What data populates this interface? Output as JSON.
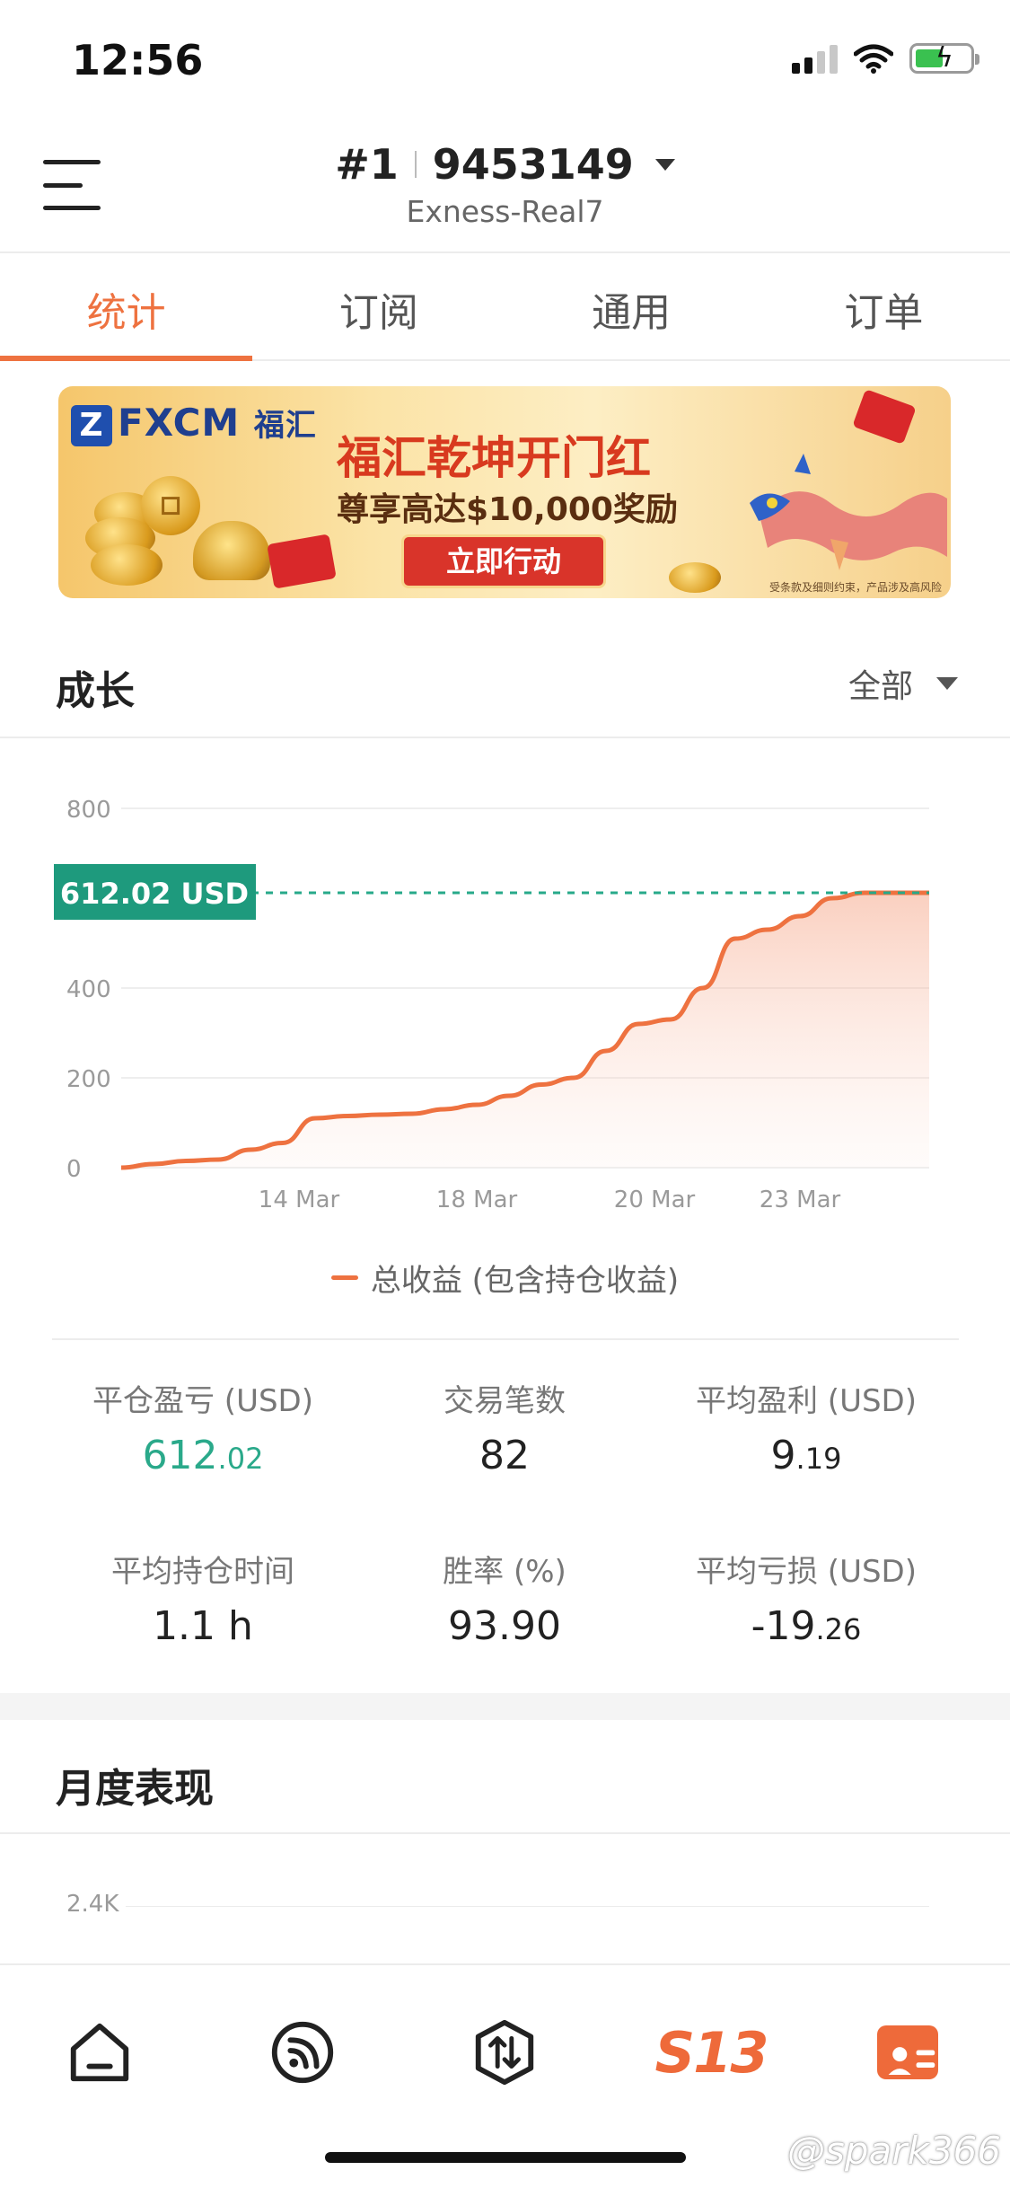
{
  "status_bar": {
    "time": "12:56"
  },
  "header": {
    "account_index": "#1",
    "account_number": "9453149",
    "server": "Exness-Real7"
  },
  "tabs": [
    {
      "label": "统计",
      "active": true
    },
    {
      "label": "订阅",
      "active": false
    },
    {
      "label": "通用",
      "active": false
    },
    {
      "label": "订单",
      "active": false
    }
  ],
  "banner": {
    "logo_text": "FXCM",
    "logo_cn": "福汇",
    "title": "福汇乾坤开门红",
    "subtitle": "尊享高达$10,000奖励",
    "cta": "立即行动",
    "fine_print": "受条款及细则约束，产品涉及高风险"
  },
  "growth": {
    "title": "成长",
    "filter": "全部",
    "current_label": "612.02 USD",
    "legend": "总收益 (包含持仓收益)"
  },
  "chart_data": {
    "type": "area",
    "title": "",
    "xlabel": "",
    "ylabel": "",
    "x_ticks": [
      "14 Mar",
      "18 Mar",
      "20 Mar",
      "23 Mar"
    ],
    "y_ticks": [
      "0",
      "200",
      "400",
      "800"
    ],
    "ylim": [
      0,
      800
    ],
    "x": [
      0,
      1,
      2,
      3,
      4,
      5,
      6,
      7,
      8,
      9,
      10,
      11,
      12,
      13,
      14,
      15,
      16,
      17,
      18,
      19,
      20,
      21,
      22,
      23,
      24,
      25
    ],
    "series": [
      {
        "name": "总收益 (包含持仓收益)",
        "values": [
          0,
          8,
          15,
          18,
          40,
          55,
          110,
          115,
          118,
          120,
          130,
          140,
          160,
          185,
          200,
          260,
          320,
          330,
          400,
          510,
          530,
          560,
          600,
          612.02,
          612.02,
          612.02
        ]
      }
    ],
    "reference_line": 612.02,
    "grid": true,
    "colors": {
      "line": "#ee7240",
      "reference": "#27a98a"
    }
  },
  "stats": {
    "closed_pnl": {
      "label": "平仓盈亏 (USD)",
      "int": "612",
      "dec": ".02"
    },
    "trades": {
      "label": "交易笔数",
      "value": "82"
    },
    "avg_profit": {
      "label": "平均盈利 (USD)",
      "int": "9",
      "dec": ".19"
    },
    "avg_hold": {
      "label": "平均持仓时间",
      "value": "1.1 h"
    },
    "win_rate": {
      "label": "胜率 (%)",
      "value": "93.90"
    },
    "avg_loss": {
      "label": "平均亏损 (USD)",
      "int": "-19",
      "dec": ".26"
    }
  },
  "monthly": {
    "title": "月度表现",
    "y_tick_top": "2.4K"
  },
  "bottom_nav": {
    "brand": "S13"
  },
  "watermark": "@spark366"
}
